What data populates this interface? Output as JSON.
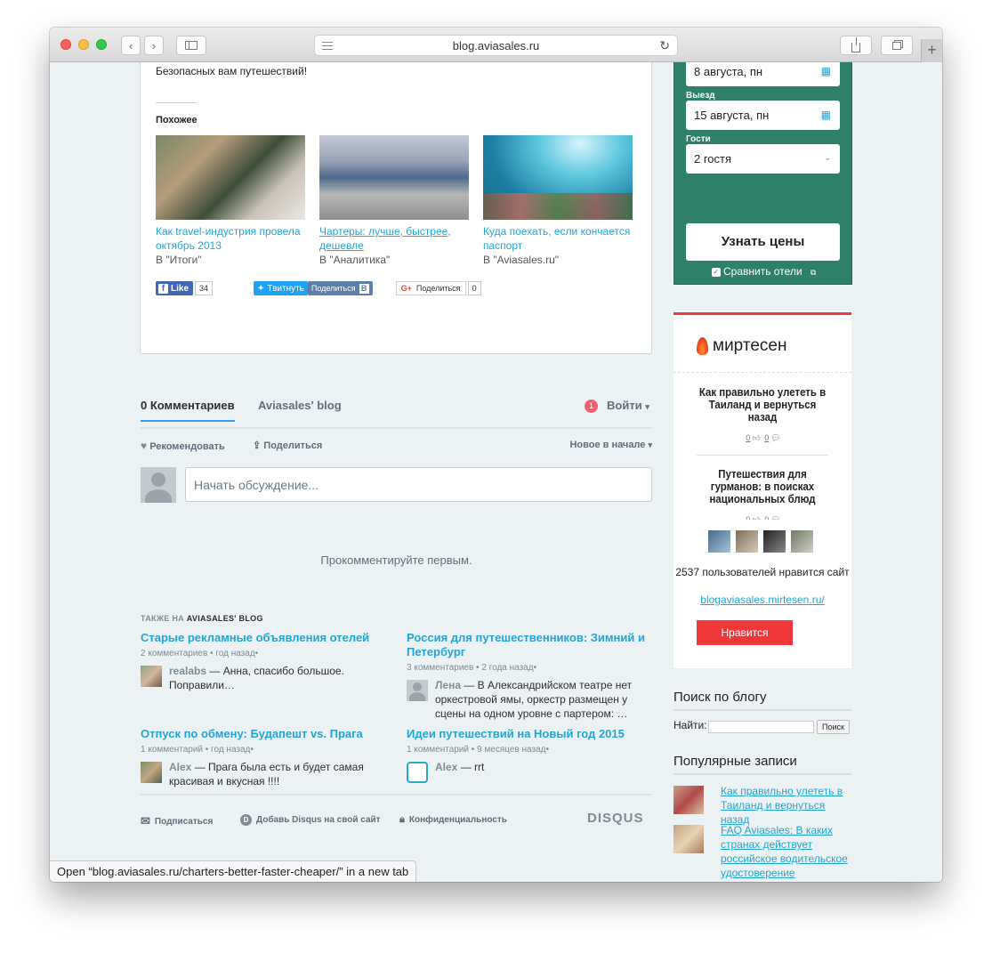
{
  "browser": {
    "url": "blog.aviasales.ru",
    "status_prefix": "Open “",
    "status_url": "blog.aviasales.ru/charters-better-faster-cheaper/",
    "status_suffix": "” in a new tab"
  },
  "article": {
    "closing_text": "Безопасных вам путешествий!",
    "similar_heading": "Похожее",
    "related": [
      {
        "title": "Как travel-индустрия провела октябрь 2013",
        "category": "В \"Итоги\""
      },
      {
        "title": "Чартеры: лучше, быстрее, дешевле",
        "category": "В \"Аналитика\""
      },
      {
        "title": "Куда поехать, если кончается паспорт",
        "category": "В \"Aviasales.ru\""
      }
    ],
    "share": {
      "fb_label": "Like",
      "fb_count": "34",
      "tw_label": "Твитнуть",
      "vk_label": "Поделиться",
      "gp_label": "Поделиться",
      "gp_count": "0"
    }
  },
  "disqus": {
    "tab_comments": "0 Комментариев",
    "tab_blog": "Aviasales' blog",
    "badge": "1",
    "login": "Войти",
    "recommend": "Рекомендовать",
    "share": "Поделиться",
    "sort": "Новое в начале",
    "comment_placeholder": "Начать обсуждение...",
    "first_comment": "Прокомментируйте первым.",
    "also_prefix": "ТАКЖЕ НА ",
    "also_site": "AVIASALES' BLOG",
    "posts": [
      {
        "title": "Старые рекламные объявления отелей",
        "meta": "2 комментариев • год назад•",
        "user": "realabs",
        "comment": " — Анна, спасибо большое. Поправили…"
      },
      {
        "title": "Россия для путешественников: Зимний и Петербург",
        "meta": "3 комментариев • 2 года назад•",
        "user": "Лена",
        "comment": " — В Александрийском театре нет оркестровой ямы, оркестр размещен у сцены на одном уровне с партером: …"
      },
      {
        "title": "Отпуск по обмену: Будапешт vs. Прага",
        "meta": "1 комментарий • год назад•",
        "user": "Alex",
        "comment": " — Прага была есть и будет самая красивая и вкусная !!!!"
      },
      {
        "title": "Идеи путешествий на Новый год 2015",
        "meta": "1 комментарий • 9 месяцев назад•",
        "user": "Alex",
        "comment": " — rrt"
      }
    ],
    "footer": {
      "subscribe": "Подписаться",
      "add_disqus": "Добавь Disqus на свой сайт",
      "privacy": "Конфиденциальность",
      "logo": "DISQUS"
    }
  },
  "booking": {
    "checkin_value": "8 августа, пн",
    "checkout_label": "Выезд",
    "checkout_value": "15 августа, пн",
    "guests_label": "Гости",
    "guests_value": "2 гостя",
    "button": "Узнать цены",
    "compare": "Сравнить отели"
  },
  "mirtesen": {
    "logo": "миртесен",
    "articles": [
      {
        "title": "Как правильно улететь в Таиланд и вернуться назад",
        "likes": "0",
        "comments": "0"
      },
      {
        "title": "Путешествия для гурманов: в поисках национальных блюд",
        "likes": "0",
        "comments": "0"
      }
    ],
    "users_text": "2537 пользователей нравится сайт",
    "site_link": "blogaviasales.mirtesen.ru/",
    "like_button": "Нравится"
  },
  "sidebar": {
    "search_heading": "Поиск по блогу",
    "search_label": "Найти:",
    "search_button": "Поиск",
    "popular_heading": "Популярные записи",
    "popular": [
      {
        "title": "Как правильно улететь в Таиланд и вернуться назад"
      },
      {
        "title": "FAQ Aviasales: В каких странах действует российское водительское удостоверение"
      }
    ]
  }
}
